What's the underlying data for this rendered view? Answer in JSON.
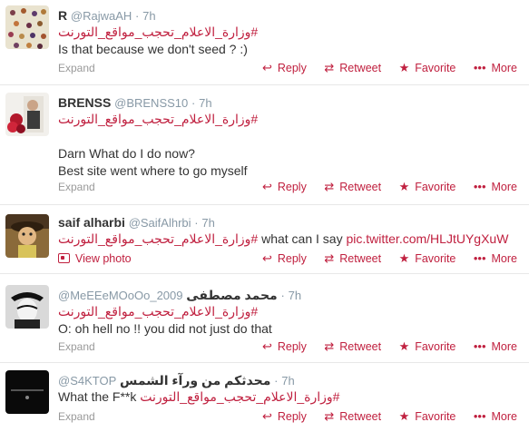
{
  "tweets": [
    {
      "fullname": "R",
      "screenname": "@RajwaAH",
      "time": "7h",
      "hashtag": "#وزارة_الاعلام_تحجب_مواقع_التورنت",
      "text": "Is that because we don't seed ? :)",
      "footer_left": "Expand"
    },
    {
      "fullname": "BRENSS",
      "screenname": "@BRENSS10",
      "time": "7h",
      "hashtag": "#وزارة_الاعلام_تحجب_مواقع_التورنت",
      "text_line1": "Darn What do I do now?",
      "text_line2": "Best site went where to go myself",
      "footer_left": "Expand"
    },
    {
      "fullname": "saif alharbi",
      "screenname": "@SaifAlhrbi",
      "time": "7h",
      "hashtag": "#وزارة_الاعلام_تحجب_مواقع_التورنت",
      "text": "what can I say",
      "link": "pic.twitter.com/HLJtUYgXuW",
      "footer_left": "View photo"
    },
    {
      "fullname": "محمد مصطفى",
      "screenname": "@MeEEeMOoOo_2009",
      "time": "7h",
      "hashtag": "#وزارة_الاعلام_تحجب_مواقع_التورنت",
      "text": "O: oh hell no !! you did not just do that",
      "footer_left": "Expand"
    },
    {
      "fullname": "محدثكم من ورآء الشمس",
      "screenname": "@S4KTOP",
      "time": "7h",
      "hashtag": "#وزارة_الاعلام_تحجب_مواقع_التورنت",
      "text": "What the F**k",
      "footer_left": "Expand"
    }
  ],
  "actions": {
    "reply": "Reply",
    "retweet": "Retweet",
    "favorite": "Favorite",
    "more": "More"
  },
  "icons": {
    "reply": "reply-arrow-icon",
    "retweet": "retweet-icon",
    "favorite": "star-icon",
    "more": "dots-icon"
  },
  "colors": {
    "accent": "#c0203f",
    "muted": "#8899a6",
    "text": "#333333"
  }
}
